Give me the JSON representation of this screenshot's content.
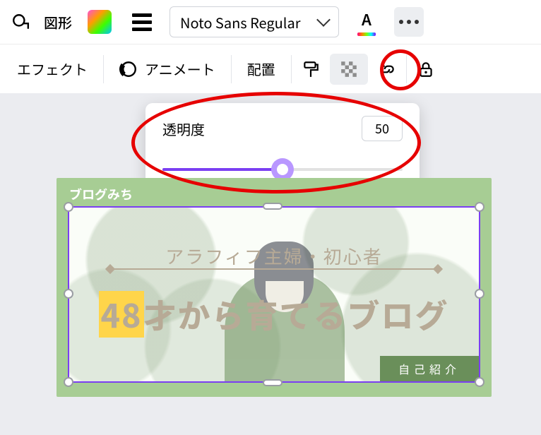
{
  "toolbar1": {
    "shape_label": "図形",
    "font_name": "Noto Sans Regular"
  },
  "toolbar2": {
    "effect": "エフェクト",
    "animate": "アニメート",
    "position": "配置"
  },
  "transparency": {
    "label": "透明度",
    "value": "50",
    "percent": 50
  },
  "canvas": {
    "site_title": "ブログみち",
    "sub_line": "アラフィフ主婦・初心者",
    "main_title_hl": "48",
    "main_title_rest": "才から育てるブログ",
    "cta": "自己紹介"
  }
}
